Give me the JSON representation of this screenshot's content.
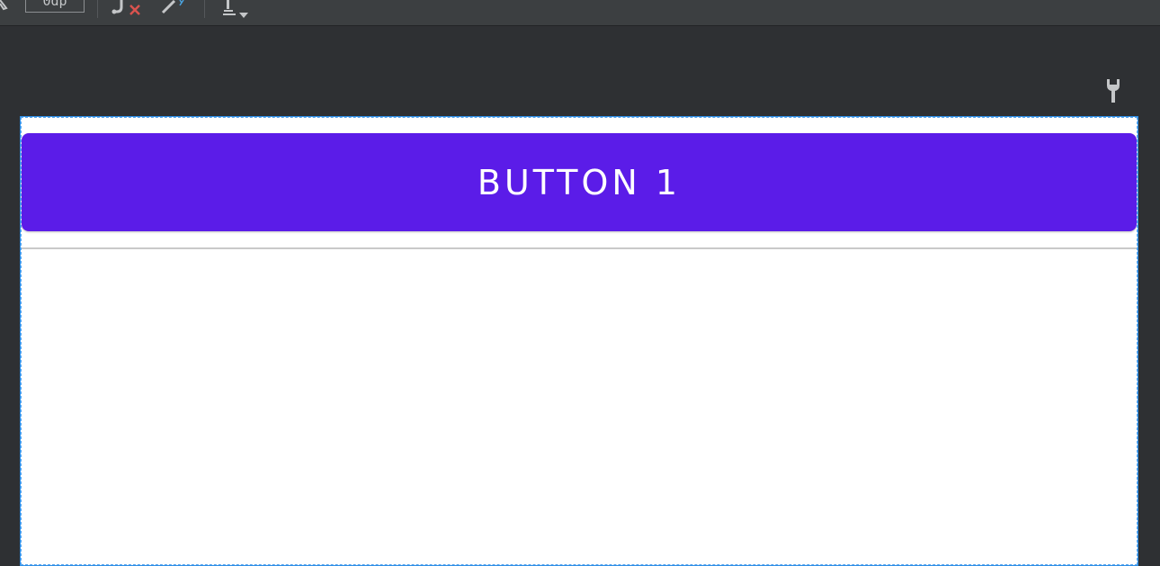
{
  "toolbar": {
    "margin_value": "0dp",
    "icons": [
      "pan-icon",
      "clear-constraints-icon",
      "infer-constraints-icon",
      "guidelines-icon"
    ]
  },
  "canvas": {
    "tools_icon": "wrench-icon",
    "button_label": "BUTTON 1",
    "colors": {
      "button": "#5b1ce8",
      "selection": "#2f8fe6",
      "background": "#2e3033",
      "toolbar": "#3c3f41"
    }
  }
}
